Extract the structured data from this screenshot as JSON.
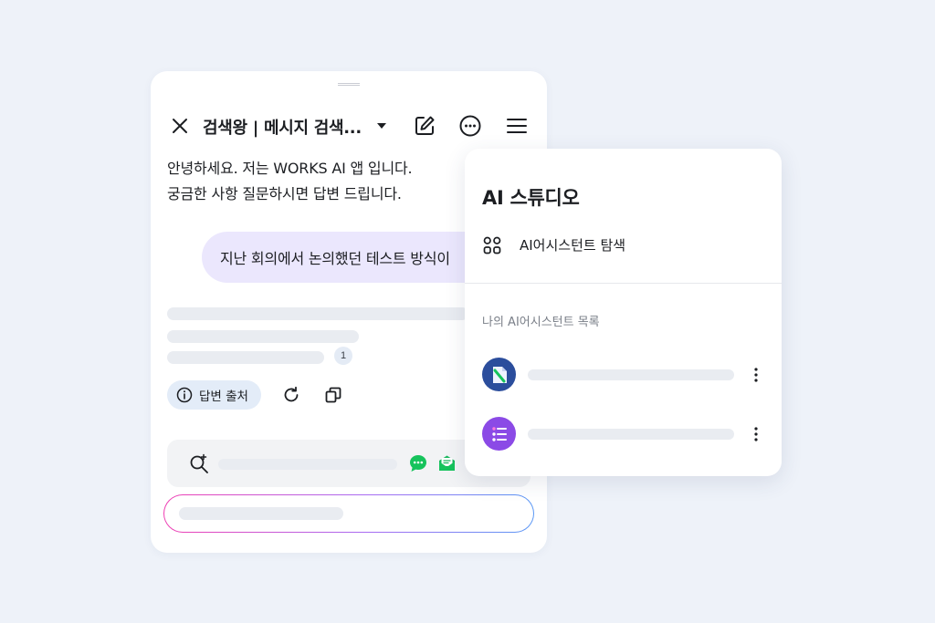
{
  "chat": {
    "title": "검색왕 | 메시지 검색...",
    "greeting_line1": "안녕하세요. 저는 WORKS AI 앱 입니다.",
    "greeting_line2": "궁금한 사항 질문하시면 답변 드립니다.",
    "user_message": "지난 회의에서 논의했던 테스트 방식이",
    "citation_number": "1",
    "source_button_label": "답변 출처"
  },
  "studio": {
    "title": "AI 스튜디오",
    "explore_label": "AI어시스턴트 탐색",
    "section_label": "나의 AI어시스턴트 목록",
    "assistants": [
      {
        "icon": "document-pen-icon",
        "color": "#2b4d9c"
      },
      {
        "icon": "list-icon",
        "color": "#8b4ae6"
      }
    ]
  },
  "colors": {
    "background": "#eef2f9",
    "user_bubble": "#ebe7fd",
    "source_chip": "#e3ecf8",
    "chat_green": "#16c35c",
    "gradient_start": "#ef3fb3",
    "gradient_end": "#5a98f5"
  }
}
